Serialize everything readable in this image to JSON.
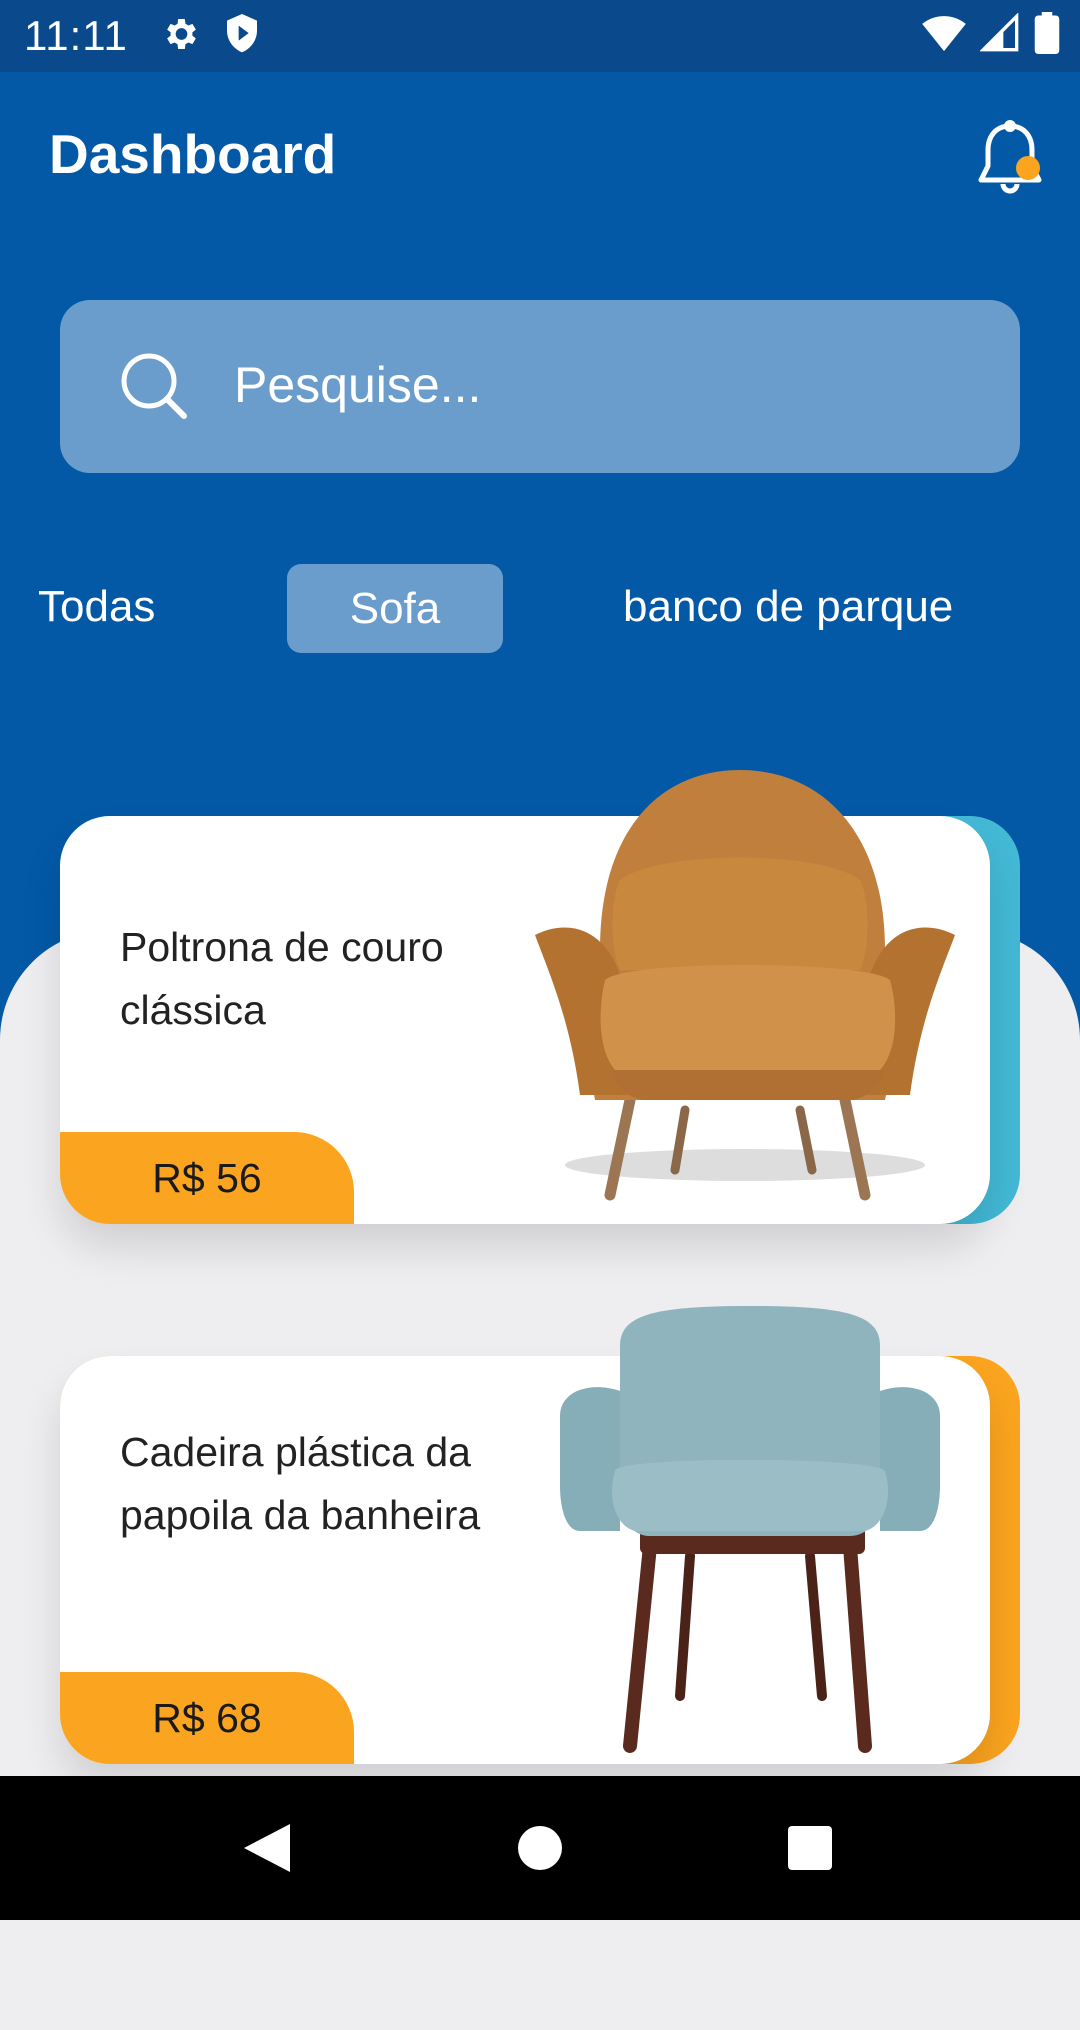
{
  "status_bar": {
    "time": "11:11"
  },
  "header": {
    "title": "Dashboard"
  },
  "search": {
    "placeholder": "Pesquise..."
  },
  "categories": [
    {
      "label": "Todas",
      "selected": false
    },
    {
      "label": "Sofa",
      "selected": true
    },
    {
      "label": "banco de parque",
      "selected": false
    }
  ],
  "products": [
    {
      "title": "Poltrona de couro clássica",
      "price": "R$ 56",
      "accent_color": "#43B9D6"
    },
    {
      "title": "Cadeira plástica da papoila da banheira",
      "price": "R$ 68",
      "accent_color": "#FBA41F"
    }
  ],
  "colors": {
    "primary": "#0359A6",
    "orange": "#FBA41F",
    "search_bg": "#6A9DCC"
  }
}
